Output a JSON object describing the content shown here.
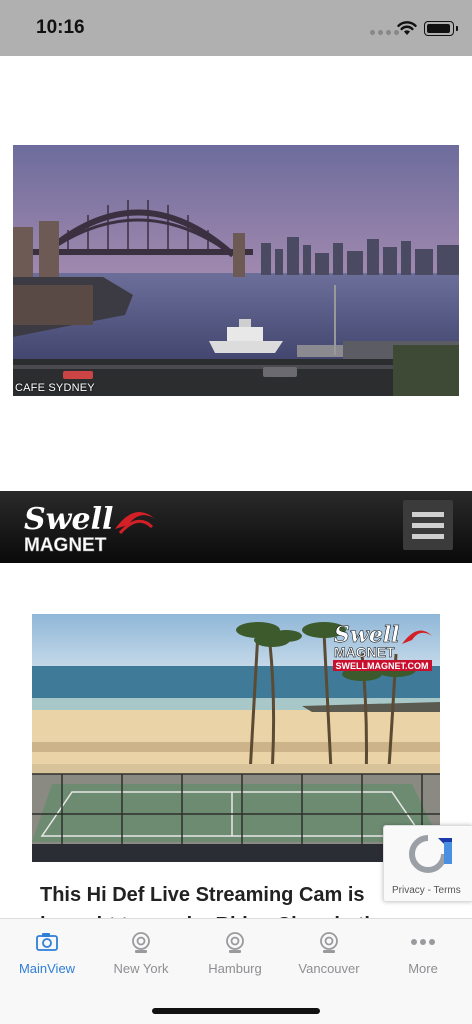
{
  "status_bar": {
    "time": "10:16"
  },
  "webcam_sydney": {
    "caption": "CAFE SYDNEY"
  },
  "site_header": {
    "logo_line1": "Swell",
    "logo_line2": "MAGNET"
  },
  "webcam_beach": {
    "watermark_line1": "Swell",
    "watermark_line2": "MAGNET",
    "watermark_url": "SWELLMAGNET.COM"
  },
  "article": {
    "title": "This Hi Def Live Streaming Cam is brought to you by Ridge Church, the most iridescent"
  },
  "recaptcha": {
    "privacy": "Privacy",
    "separator": " - ",
    "terms": "Terms"
  },
  "tab_bar": {
    "tabs": [
      {
        "label": "MainView",
        "icon": "camera-icon",
        "active": true
      },
      {
        "label": "New York",
        "icon": "webcam-icon",
        "active": false
      },
      {
        "label": "Hamburg",
        "icon": "webcam-icon",
        "active": false
      },
      {
        "label": "Vancouver",
        "icon": "webcam-icon",
        "active": false
      },
      {
        "label": "More",
        "icon": "more-icon",
        "active": false
      }
    ]
  },
  "colors": {
    "accent": "#2f7ed8",
    "tab_inactive": "#8e8e93",
    "header_bg": "#111111",
    "status_bar_bg": "#b0b0b0"
  }
}
